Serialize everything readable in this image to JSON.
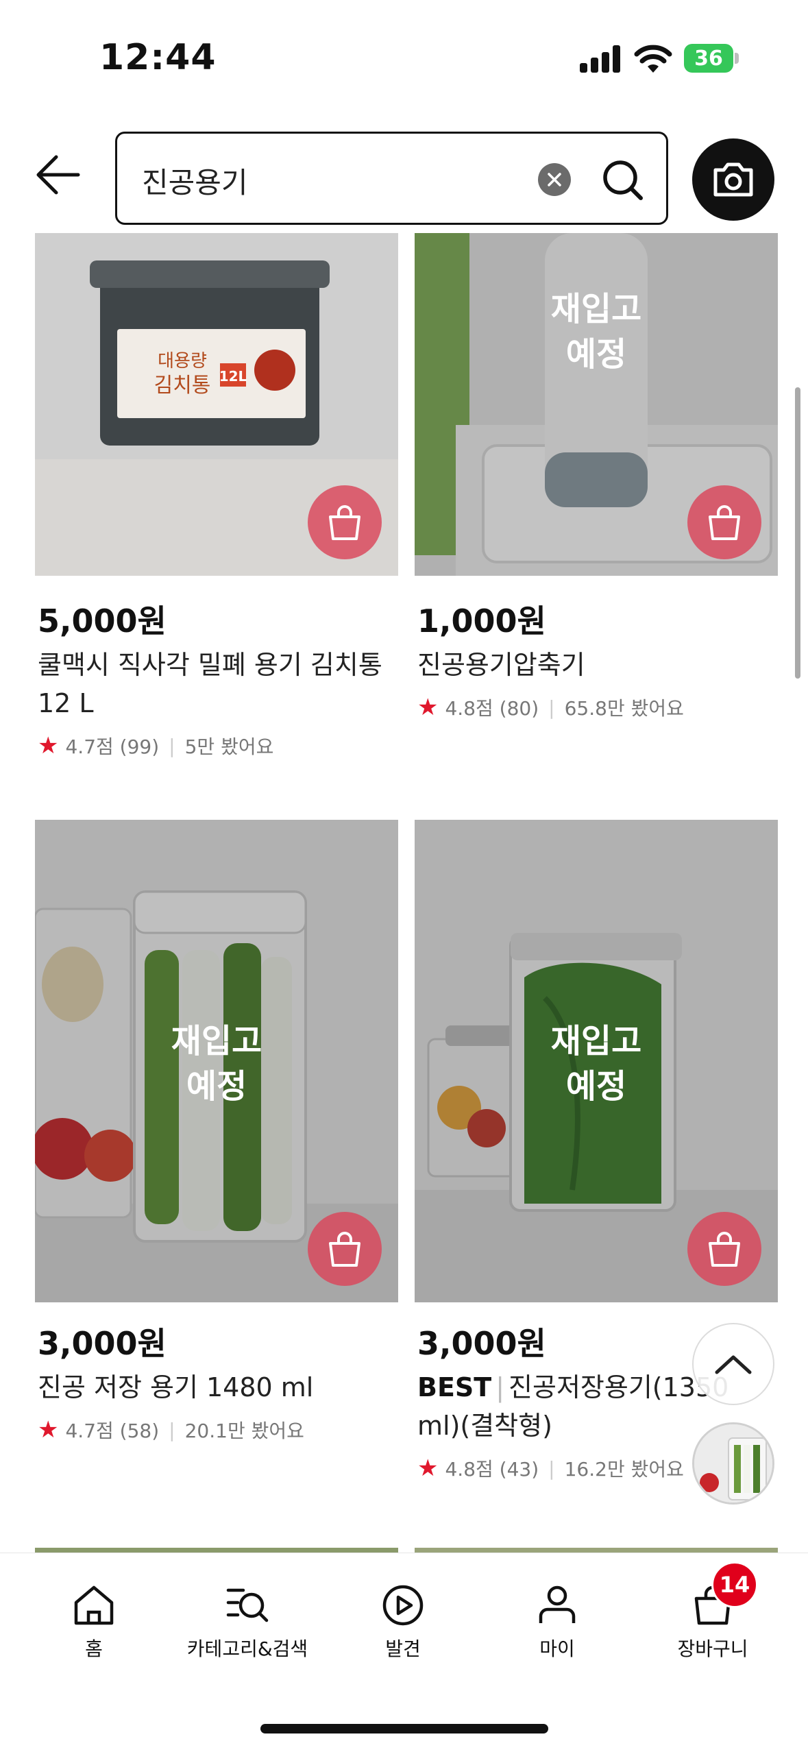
{
  "status_bar": {
    "time": "12:44",
    "battery": "36"
  },
  "search": {
    "query": "진공용기"
  },
  "products": [
    {
      "price": "5,000원",
      "name": "쿨맥시 직사각 밀폐 용기 김치통 12 L",
      "rating": "4.7점 (99)",
      "views": "5만 봤어요",
      "restock": "",
      "best": ""
    },
    {
      "price": "1,000원",
      "name": "진공용기압축기",
      "rating": "4.8점 (80)",
      "views": "65.8만 봤어요",
      "restock_line1": "재입고",
      "restock_line2": "예정",
      "best": ""
    },
    {
      "price": "3,000원",
      "name": "진공 저장 용기 1480 ml",
      "rating": "4.7점 (58)",
      "views": "20.1만 봤어요",
      "restock_line1": "재입고",
      "restock_line2": "예정",
      "best": ""
    },
    {
      "price": "3,000원",
      "name": "진공저장용기(1350 ml)(결착형)",
      "rating": "4.8점 (43)",
      "views": "16.2만 봤어요",
      "restock_line1": "재입고",
      "restock_line2": "예정",
      "best": "BEST"
    }
  ],
  "kimchi_label": {
    "line1": "대용량",
    "line2": "김치통",
    "size": "12L"
  },
  "nav": {
    "items": [
      {
        "label": "홈",
        "icon": "home-icon"
      },
      {
        "label": "카테고리&검색",
        "icon": "category-search-icon"
      },
      {
        "label": "발견",
        "icon": "play-discover-icon"
      },
      {
        "label": "마이",
        "icon": "person-icon"
      },
      {
        "label": "장바구니",
        "icon": "cart-icon"
      }
    ],
    "cart_count": "14"
  },
  "colors": {
    "accent": "#e0001b",
    "cart_button": "#da465a",
    "star": "#e0182d"
  }
}
